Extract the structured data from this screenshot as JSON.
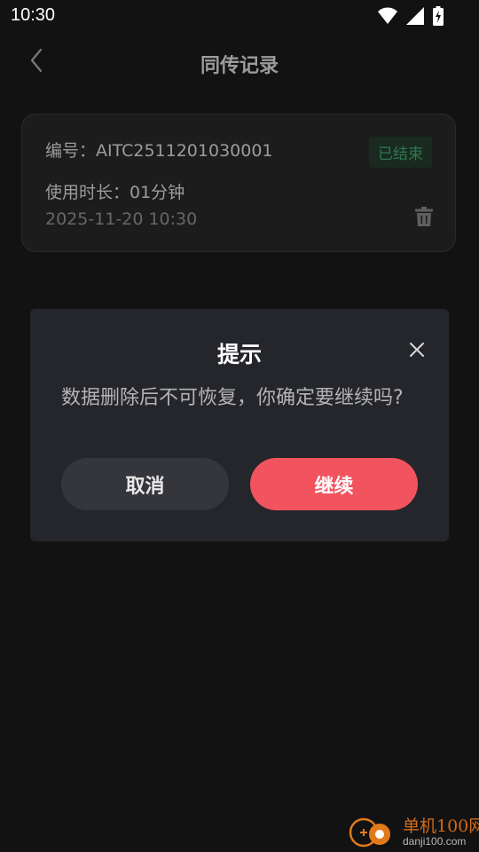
{
  "status_bar": {
    "time": "10:30",
    "icons": [
      "wifi-icon",
      "signal-icon",
      "battery-charging-icon"
    ]
  },
  "header": {
    "title": "同传记录",
    "back_icon": "chevron-left-icon"
  },
  "record": {
    "id_text": "编号：AITC2511201030001",
    "status_badge": "已结束",
    "duration_text": "使用时长：01分钟",
    "timestamp": "2025-11-20 10:30",
    "delete_icon": "trash-icon"
  },
  "dialog": {
    "title": "提示",
    "message": "数据删除后不可恢复，你确定要继续吗?",
    "cancel_label": "取消",
    "confirm_label": "继续",
    "close_icon": "close-icon"
  },
  "watermark": {
    "name": "单机100网",
    "url": "danji100.com"
  },
  "colors": {
    "background": "#121212",
    "card": "#1c1c1c",
    "dialog": "#25262b",
    "accent": "#f1545f",
    "status_ended": "#2b7a4d"
  }
}
